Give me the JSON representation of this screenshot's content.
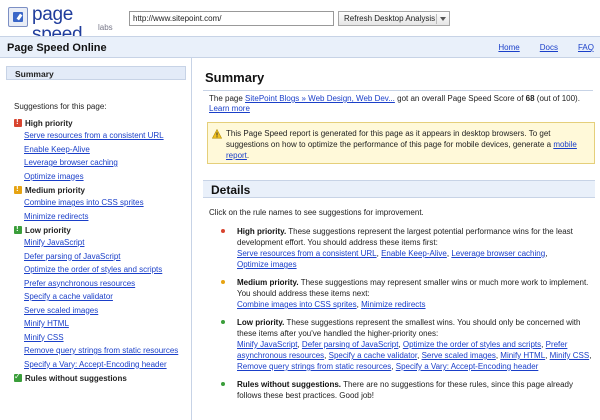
{
  "topbar": {
    "logo_text": "page speed",
    "logo_sub": "labs",
    "url_value": "http://www.sitepoint.com/",
    "analyze_label": "Refresh Desktop Analysis"
  },
  "titlebar": {
    "title": "Page Speed Online",
    "nav": [
      "Home",
      "Docs",
      "FAQ"
    ]
  },
  "sidebar": {
    "summary_label": "Summary",
    "heading": "Suggestions for this page:",
    "high": {
      "label": "High priority",
      "items": [
        "Serve resources from a consistent URL",
        "Enable Keep-Alive",
        "Leverage browser caching",
        "Optimize images"
      ]
    },
    "medium": {
      "label": "Medium priority",
      "items": [
        "Combine images into CSS sprites",
        "Minimize redirects"
      ]
    },
    "low": {
      "label": "Low priority",
      "items": [
        "Minify JavaScript",
        "Defer parsing of JavaScript",
        "Optimize the order of styles and scripts",
        "Prefer asynchronous resources",
        "Specify a cache validator",
        "Serve scaled images",
        "Minify HTML",
        "Minify CSS",
        "Remove query strings from static resources",
        "Specify a Vary: Accept-Encoding header"
      ]
    },
    "none": {
      "label": "Rules without suggestions"
    }
  },
  "main": {
    "title": "Summary",
    "score": {
      "prefix": "The page ",
      "page_link": "SitePoint Blogs » Web Design, Web Dev...",
      "middle": " got an overall Page Speed Score of ",
      "value": "68",
      "suffix": " (out of 100).",
      "learn_more": "Learn more"
    },
    "note": {
      "text": "This Page Speed report is generated for this page as it appears in desktop browsers. To get suggestions on how to optimize the performance of this page for mobile devices, generate a ",
      "link": "mobile report",
      "end": "."
    },
    "details_title": "Details",
    "intro": "Click on the rule names to see suggestions for improvement.",
    "high": {
      "label": "High priority.",
      "text": " These suggestions represent the largest potential performance wins for the least development effort. You should address these items first:",
      "links": [
        "Serve resources from a consistent URL",
        "Enable Keep-Alive",
        "Leverage browser caching",
        "Optimize images"
      ]
    },
    "medium": {
      "label": "Medium priority.",
      "text": " These suggestions may represent smaller wins or much more work to implement. You should address these items next:",
      "links": [
        "Combine images into CSS sprites",
        "Minimize redirects"
      ]
    },
    "low": {
      "label": "Low priority.",
      "text": " These suggestions represent the smallest wins. You should only be concerned with these items after you've handled the higher-priority ones:",
      "links": [
        "Minify JavaScript",
        "Defer parsing of JavaScript",
        "Optimize the order of styles and scripts",
        "Prefer asynchronous resources",
        "Specify a cache validator",
        "Serve scaled images",
        "Minify HTML",
        "Minify CSS",
        "Remove query strings from static resources",
        "Specify a Vary: Accept-Encoding header"
      ]
    },
    "none": {
      "label": "Rules without suggestions.",
      "text": " There are no suggestions for these rules, since this page already follows these best practices. Good job!"
    }
  },
  "colors": {
    "accent_blue": "#1a3fc9",
    "high": "#d8442f",
    "medium": "#e6a312",
    "low": "#3a9e3a",
    "header_bg": "#e9f0fa",
    "note_bg": "#fff9d9"
  }
}
